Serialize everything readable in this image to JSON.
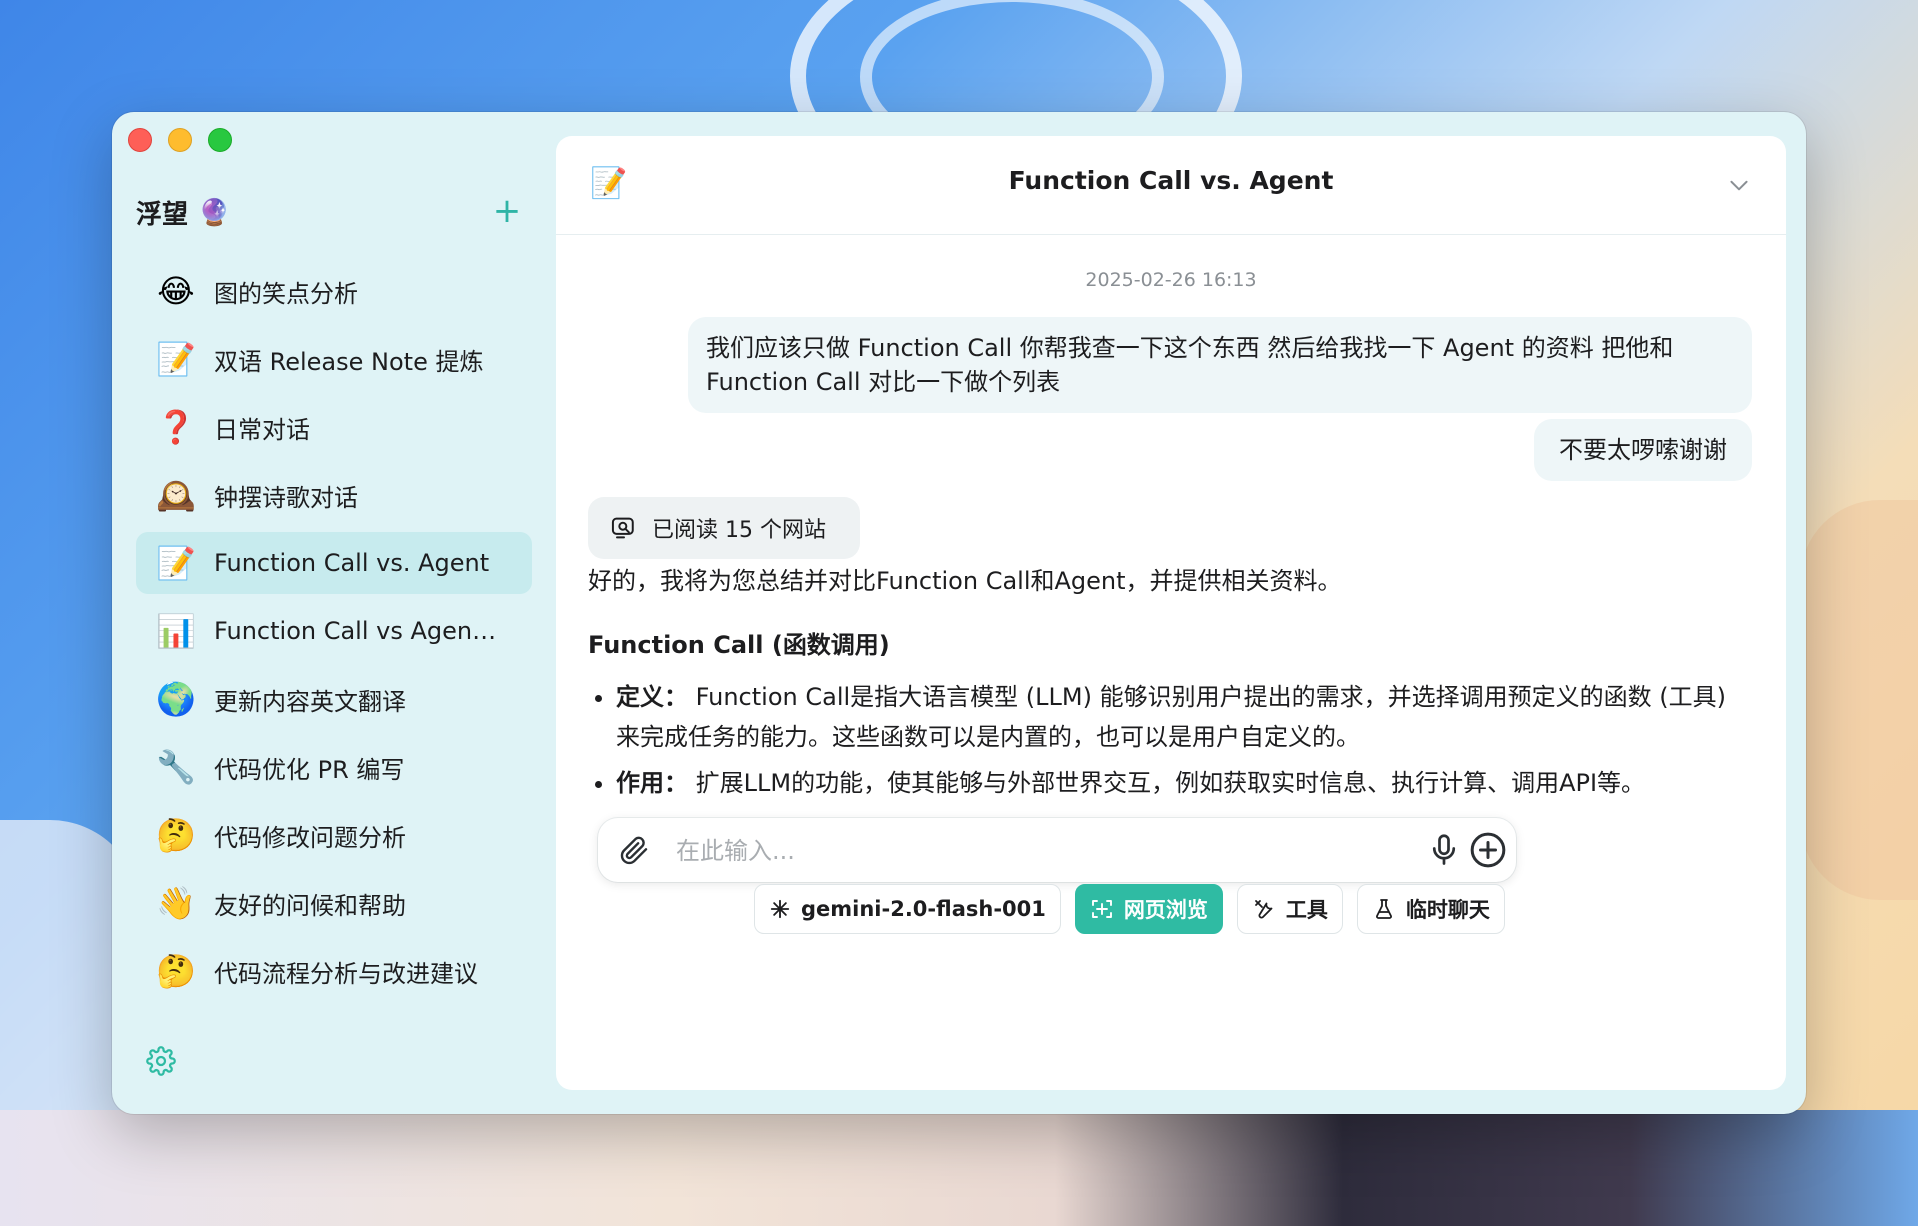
{
  "sidebar": {
    "title": "浮望",
    "title_emoji": "🔮",
    "new_button_label": "+",
    "conversations": [
      {
        "icon": "😂",
        "title": "图的笑点分析"
      },
      {
        "icon": "📝",
        "title": "双语 Release Note 提炼"
      },
      {
        "icon": "❓",
        "title": "日常对话"
      },
      {
        "icon": "🕰️",
        "title": "钟摆诗歌对话"
      },
      {
        "icon": "📝",
        "title": "Function Call vs. Agent",
        "active": true
      },
      {
        "icon": "📊",
        "title": "Function Call vs Agent..."
      },
      {
        "icon": "🌍",
        "title": "更新内容英文翻译"
      },
      {
        "icon": "🔧",
        "title": "代码优化 PR 编写"
      },
      {
        "icon": "🤔",
        "title": "代码修改问题分析"
      },
      {
        "icon": "👋",
        "title": "友好的问候和帮助"
      },
      {
        "icon": "🤔",
        "title": "代码流程分析与改进建议"
      }
    ]
  },
  "chat": {
    "header": {
      "emoji": "📝",
      "title": "Function Call vs. Agent"
    },
    "timestamp": "2025-02-26 16:13",
    "user_messages": [
      "我们应该只做 Function Call 你帮我查一下这个东西 然后给我找一下 Agent 的资料 把他和 Function Call 对比一下做个列表",
      "不要太啰嗦谢谢"
    ],
    "read_sites": "已阅读 15 个网站",
    "answer": {
      "intro": "好的，我将为您总结并对比Function Call和Agent，并提供相关资料。",
      "heading": "Function Call (函数调用)",
      "items": [
        {
          "label": "定义：",
          "text": "Function Call是指大语言模型 (LLM) 能够识别用户提出的需求，并选择调用预定义的函数 (工具) 来完成任务的能力。这些函数可以是内置的，也可以是用户自定义的。"
        },
        {
          "label": "作用：",
          "text": "扩展LLM的功能，使其能够与外部世界交互，例如获取实时信息、执行计算、调用API等。"
        }
      ]
    }
  },
  "composer": {
    "placeholder": "在此输入...",
    "value": ""
  },
  "toolbar": {
    "model": "gemini-2.0-flash-001",
    "web_browse": "网页浏览",
    "tools": "工具",
    "temp_chat": "临时聊天"
  },
  "colors": {
    "accent": "#2fbba3",
    "sidebar_bg": "#dff3f6",
    "active_item_bg": "#c7ebee"
  }
}
